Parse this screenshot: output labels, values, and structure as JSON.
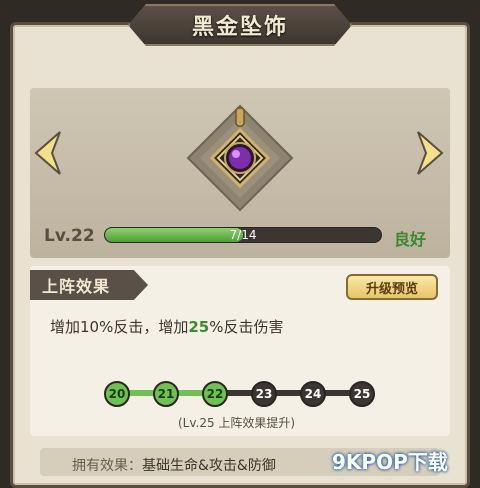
{
  "title": "黑金坠饰",
  "item": {
    "icon": "pendant-icon",
    "level_label": "Lv.22",
    "xp_text": "7/14",
    "xp_fraction": 0.5,
    "status": "良好"
  },
  "effect": {
    "tab_label": "上阵效果",
    "preview_button": "升级预览",
    "desc_prefix": "增加10%反击，增加",
    "desc_highlight": "25",
    "desc_suffix": "%反击伤害",
    "levels": [
      "20",
      "21",
      "22",
      "23",
      "24",
      "25"
    ],
    "levels_reached": 3,
    "note": "(Lv.25 上阵效果提升)"
  },
  "owned": {
    "label": "拥有效果：",
    "value": "基础生命&攻击&防御"
  },
  "watermark": "9KPOP下载",
  "colors": {
    "accent_green": "#6fc153",
    "panel_bg": "#e9e2d2",
    "plate_dark": "#5b5047"
  }
}
